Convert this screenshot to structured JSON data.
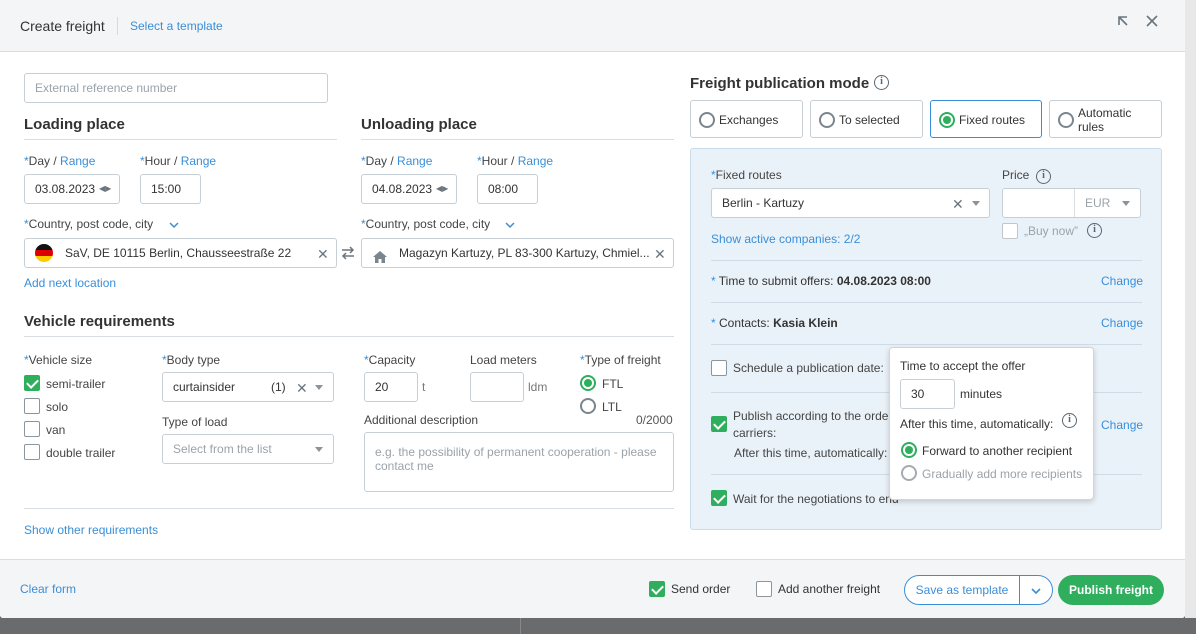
{
  "header": {
    "title": "Create freight",
    "select_template": "Select a template"
  },
  "left": {
    "external_ref_placeholder": "External reference number",
    "loading": {
      "title": "Loading place",
      "day_label": "Day",
      "range": "Range",
      "hour_label": "Hour",
      "date": "03.08.2023",
      "hour": "15:00",
      "country_label": "Country, post code, city",
      "address": "SaV, DE 10115 Berlin, Chausseestraße 22",
      "add_next": "Add next location"
    },
    "unloading": {
      "title": "Unloading place",
      "day_label": "Day",
      "range": "Range",
      "hour_label": "Hour",
      "date": "04.08.2023",
      "hour": "08:00",
      "country_label": "Country, post code, city",
      "address": "Magazyn Kartuzy, PL 83-300 Kartuzy, Chmiel..."
    },
    "vehicle": {
      "title": "Vehicle requirements",
      "size_label": "Vehicle size",
      "sizes": [
        {
          "label": "semi-trailer",
          "checked": true
        },
        {
          "label": "solo",
          "checked": false
        },
        {
          "label": "van",
          "checked": false
        },
        {
          "label": "double trailer",
          "checked": false
        }
      ],
      "body_label": "Body type",
      "body_value": "curtainsider",
      "body_count": "(1)",
      "load_type_label": "Type of load",
      "load_type_placeholder": "Select from the list",
      "capacity_label": "Capacity",
      "capacity_value": "20",
      "capacity_unit": "t",
      "load_meters_label": "Load meters",
      "load_meters_unit": "ldm",
      "freight_type_label": "Type of freight",
      "freight_types": [
        {
          "label": "FTL",
          "selected": true
        },
        {
          "label": "LTL",
          "selected": false
        }
      ],
      "desc_label": "Additional description",
      "desc_count": "0/2000",
      "desc_placeholder": "e.g. the possibility of permanent cooperation - please contact me",
      "show_other": "Show other requirements"
    }
  },
  "right": {
    "title": "Freight publication mode",
    "modes": [
      {
        "label": "Exchanges",
        "selected": false
      },
      {
        "label": "To selected",
        "selected": false
      },
      {
        "label": "Fixed routes",
        "selected": true
      },
      {
        "label": "Automatic rules",
        "selected": false
      }
    ],
    "fixed_routes_label": "Fixed routes",
    "fixed_routes_value": "Berlin - Kartuzy",
    "price_label": "Price",
    "currency": "EUR",
    "buy_now": "„Buy now”",
    "show_active": "Show active companies: 2/2",
    "time_submit_label": "Time to submit offers:",
    "time_submit_value": "04.08.2023 08:00",
    "contacts_label": "Contacts:",
    "contacts_value": "Kasia Klein",
    "change": "Change",
    "schedule_label": "Schedule a publication date:",
    "publish_order_line1": "Publish according to the order",
    "publish_order_line2": "carriers:",
    "after_time": "After this time, automatically:",
    "wait_negotiations": "Wait for the negotiations to end"
  },
  "popover": {
    "title": "Time to accept the offer",
    "minutes_value": "30",
    "minutes_label": "minutes",
    "after_label": "After this time, automatically:",
    "options": [
      {
        "label": "Forward to another recipient",
        "selected": true
      },
      {
        "label": "Gradually add more recipients",
        "selected": false
      }
    ]
  },
  "footer": {
    "clear_form": "Clear form",
    "send_order": "Send order",
    "add_another": "Add another freight",
    "save_template": "Save as template",
    "publish": "Publish freight"
  },
  "colors": {
    "accent": "#3a8ed8",
    "green": "#2fae5e",
    "panel_bg": "#eaf2f9"
  }
}
